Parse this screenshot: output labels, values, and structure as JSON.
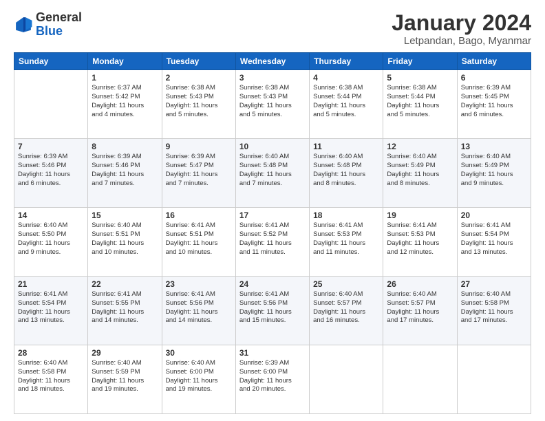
{
  "header": {
    "logo_general": "General",
    "logo_blue": "Blue",
    "main_title": "January 2024",
    "subtitle": "Letpandan, Bago, Myanmar"
  },
  "calendar": {
    "days_of_week": [
      "Sunday",
      "Monday",
      "Tuesday",
      "Wednesday",
      "Thursday",
      "Friday",
      "Saturday"
    ],
    "weeks": [
      [
        {
          "day": "",
          "info": ""
        },
        {
          "day": "1",
          "info": "Sunrise: 6:37 AM\nSunset: 5:42 PM\nDaylight: 11 hours\nand 4 minutes."
        },
        {
          "day": "2",
          "info": "Sunrise: 6:38 AM\nSunset: 5:43 PM\nDaylight: 11 hours\nand 5 minutes."
        },
        {
          "day": "3",
          "info": "Sunrise: 6:38 AM\nSunset: 5:43 PM\nDaylight: 11 hours\nand 5 minutes."
        },
        {
          "day": "4",
          "info": "Sunrise: 6:38 AM\nSunset: 5:44 PM\nDaylight: 11 hours\nand 5 minutes."
        },
        {
          "day": "5",
          "info": "Sunrise: 6:38 AM\nSunset: 5:44 PM\nDaylight: 11 hours\nand 5 minutes."
        },
        {
          "day": "6",
          "info": "Sunrise: 6:39 AM\nSunset: 5:45 PM\nDaylight: 11 hours\nand 6 minutes."
        }
      ],
      [
        {
          "day": "7",
          "info": "Sunrise: 6:39 AM\nSunset: 5:46 PM\nDaylight: 11 hours\nand 6 minutes."
        },
        {
          "day": "8",
          "info": "Sunrise: 6:39 AM\nSunset: 5:46 PM\nDaylight: 11 hours\nand 7 minutes."
        },
        {
          "day": "9",
          "info": "Sunrise: 6:39 AM\nSunset: 5:47 PM\nDaylight: 11 hours\nand 7 minutes."
        },
        {
          "day": "10",
          "info": "Sunrise: 6:40 AM\nSunset: 5:48 PM\nDaylight: 11 hours\nand 7 minutes."
        },
        {
          "day": "11",
          "info": "Sunrise: 6:40 AM\nSunset: 5:48 PM\nDaylight: 11 hours\nand 8 minutes."
        },
        {
          "day": "12",
          "info": "Sunrise: 6:40 AM\nSunset: 5:49 PM\nDaylight: 11 hours\nand 8 minutes."
        },
        {
          "day": "13",
          "info": "Sunrise: 6:40 AM\nSunset: 5:49 PM\nDaylight: 11 hours\nand 9 minutes."
        }
      ],
      [
        {
          "day": "14",
          "info": "Sunrise: 6:40 AM\nSunset: 5:50 PM\nDaylight: 11 hours\nand 9 minutes."
        },
        {
          "day": "15",
          "info": "Sunrise: 6:40 AM\nSunset: 5:51 PM\nDaylight: 11 hours\nand 10 minutes."
        },
        {
          "day": "16",
          "info": "Sunrise: 6:41 AM\nSunset: 5:51 PM\nDaylight: 11 hours\nand 10 minutes."
        },
        {
          "day": "17",
          "info": "Sunrise: 6:41 AM\nSunset: 5:52 PM\nDaylight: 11 hours\nand 11 minutes."
        },
        {
          "day": "18",
          "info": "Sunrise: 6:41 AM\nSunset: 5:53 PM\nDaylight: 11 hours\nand 11 minutes."
        },
        {
          "day": "19",
          "info": "Sunrise: 6:41 AM\nSunset: 5:53 PM\nDaylight: 11 hours\nand 12 minutes."
        },
        {
          "day": "20",
          "info": "Sunrise: 6:41 AM\nSunset: 5:54 PM\nDaylight: 11 hours\nand 13 minutes."
        }
      ],
      [
        {
          "day": "21",
          "info": "Sunrise: 6:41 AM\nSunset: 5:54 PM\nDaylight: 11 hours\nand 13 minutes."
        },
        {
          "day": "22",
          "info": "Sunrise: 6:41 AM\nSunset: 5:55 PM\nDaylight: 11 hours\nand 14 minutes."
        },
        {
          "day": "23",
          "info": "Sunrise: 6:41 AM\nSunset: 5:56 PM\nDaylight: 11 hours\nand 14 minutes."
        },
        {
          "day": "24",
          "info": "Sunrise: 6:41 AM\nSunset: 5:56 PM\nDaylight: 11 hours\nand 15 minutes."
        },
        {
          "day": "25",
          "info": "Sunrise: 6:40 AM\nSunset: 5:57 PM\nDaylight: 11 hours\nand 16 minutes."
        },
        {
          "day": "26",
          "info": "Sunrise: 6:40 AM\nSunset: 5:57 PM\nDaylight: 11 hours\nand 17 minutes."
        },
        {
          "day": "27",
          "info": "Sunrise: 6:40 AM\nSunset: 5:58 PM\nDaylight: 11 hours\nand 17 minutes."
        }
      ],
      [
        {
          "day": "28",
          "info": "Sunrise: 6:40 AM\nSunset: 5:58 PM\nDaylight: 11 hours\nand 18 minutes."
        },
        {
          "day": "29",
          "info": "Sunrise: 6:40 AM\nSunset: 5:59 PM\nDaylight: 11 hours\nand 19 minutes."
        },
        {
          "day": "30",
          "info": "Sunrise: 6:40 AM\nSunset: 6:00 PM\nDaylight: 11 hours\nand 19 minutes."
        },
        {
          "day": "31",
          "info": "Sunrise: 6:39 AM\nSunset: 6:00 PM\nDaylight: 11 hours\nand 20 minutes."
        },
        {
          "day": "",
          "info": ""
        },
        {
          "day": "",
          "info": ""
        },
        {
          "day": "",
          "info": ""
        }
      ]
    ]
  }
}
